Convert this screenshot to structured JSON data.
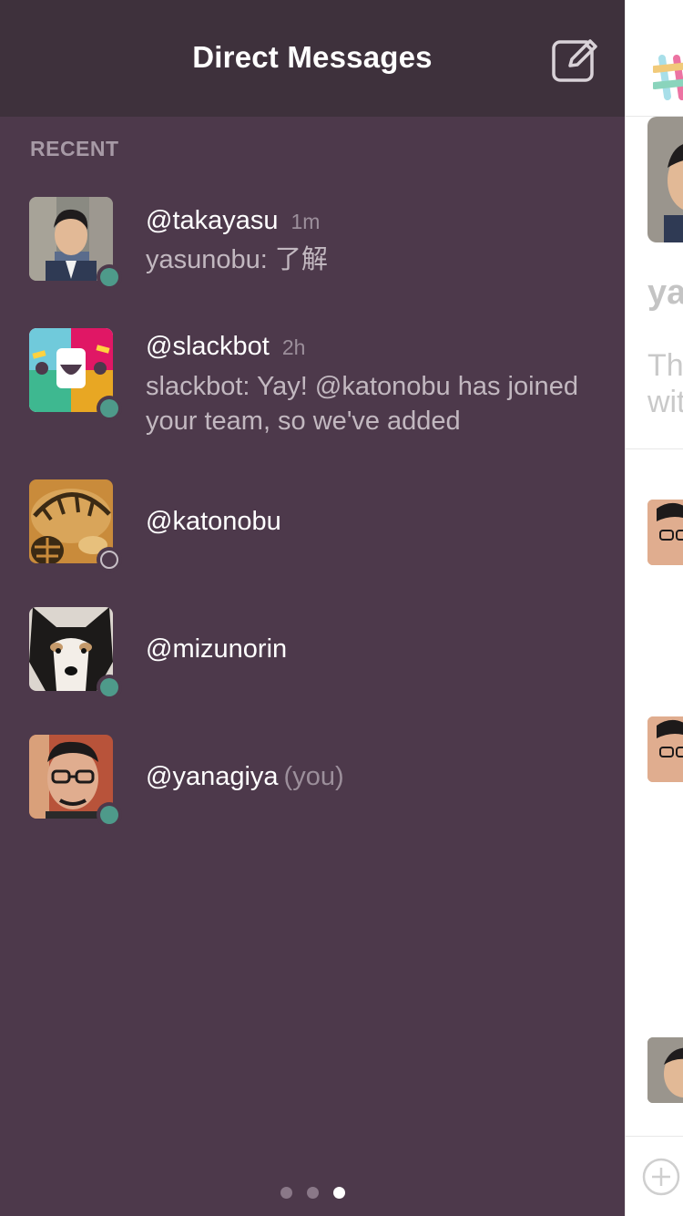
{
  "header": {
    "title": "Direct Messages",
    "compose_icon": "compose-icon"
  },
  "section": {
    "label": "RECENT"
  },
  "conversations": [
    {
      "name": "@takayasu",
      "time": "1m",
      "preview": "yasunobu: 了解",
      "status": "active",
      "you": ""
    },
    {
      "name": "@slackbot",
      "time": "2h",
      "preview": "slackbot: Yay! @katonobu has joined your team, so we've added",
      "status": "active",
      "you": ""
    },
    {
      "name": "@katonobu",
      "time": "",
      "preview": "",
      "status": "away",
      "you": ""
    },
    {
      "name": "@mizunorin",
      "time": "",
      "preview": "",
      "status": "active",
      "you": ""
    },
    {
      "name": "@yanagiya",
      "time": "",
      "preview": "",
      "status": "active",
      "you": "(you)"
    }
  ],
  "pager": {
    "pages": 3,
    "current": 3
  },
  "peek": {
    "title_fragment": "ya",
    "text_line_1": "Thi",
    "text_line_2": "wit"
  },
  "colors": {
    "drawer_bg": "#4d394b",
    "header_bg": "#3e313c",
    "presence_active": "#4e9a8a",
    "muted_text": "#9c8f9b"
  }
}
